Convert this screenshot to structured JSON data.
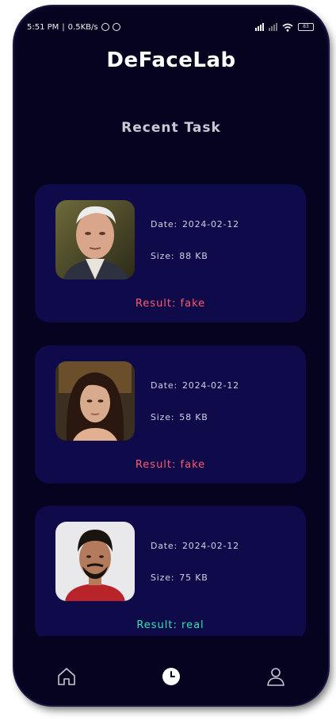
{
  "status_bar": {
    "time": "5:51 PM",
    "separator": "|",
    "net_speed": "0.5KB/s",
    "battery": "83"
  },
  "app": {
    "title": "DeFaceLab"
  },
  "section": {
    "title": "Recent  Task"
  },
  "tasks": [
    {
      "date_label": "Date:",
      "date": "2024-02-12",
      "size_label": "Size:",
      "size": "88 KB",
      "result_label": "Result:",
      "result": "fake"
    },
    {
      "date_label": "Date:",
      "date": "2024-02-12",
      "size_label": "Size:",
      "size": "58 KB",
      "result_label": "Result:",
      "result": "fake"
    },
    {
      "date_label": "Date:",
      "date": "2024-02-12",
      "size_label": "Size:",
      "size": "75 KB",
      "result_label": "Result:",
      "result": "real"
    }
  ],
  "bottom_nav": {
    "items": [
      {
        "icon": "home-icon"
      },
      {
        "icon": "history-icon",
        "active": true
      },
      {
        "icon": "profile-icon"
      }
    ]
  },
  "colors": {
    "background": "#050320",
    "card": "#0f0b4b",
    "fake": "#ff5a6a",
    "real": "#2ee6b0"
  }
}
